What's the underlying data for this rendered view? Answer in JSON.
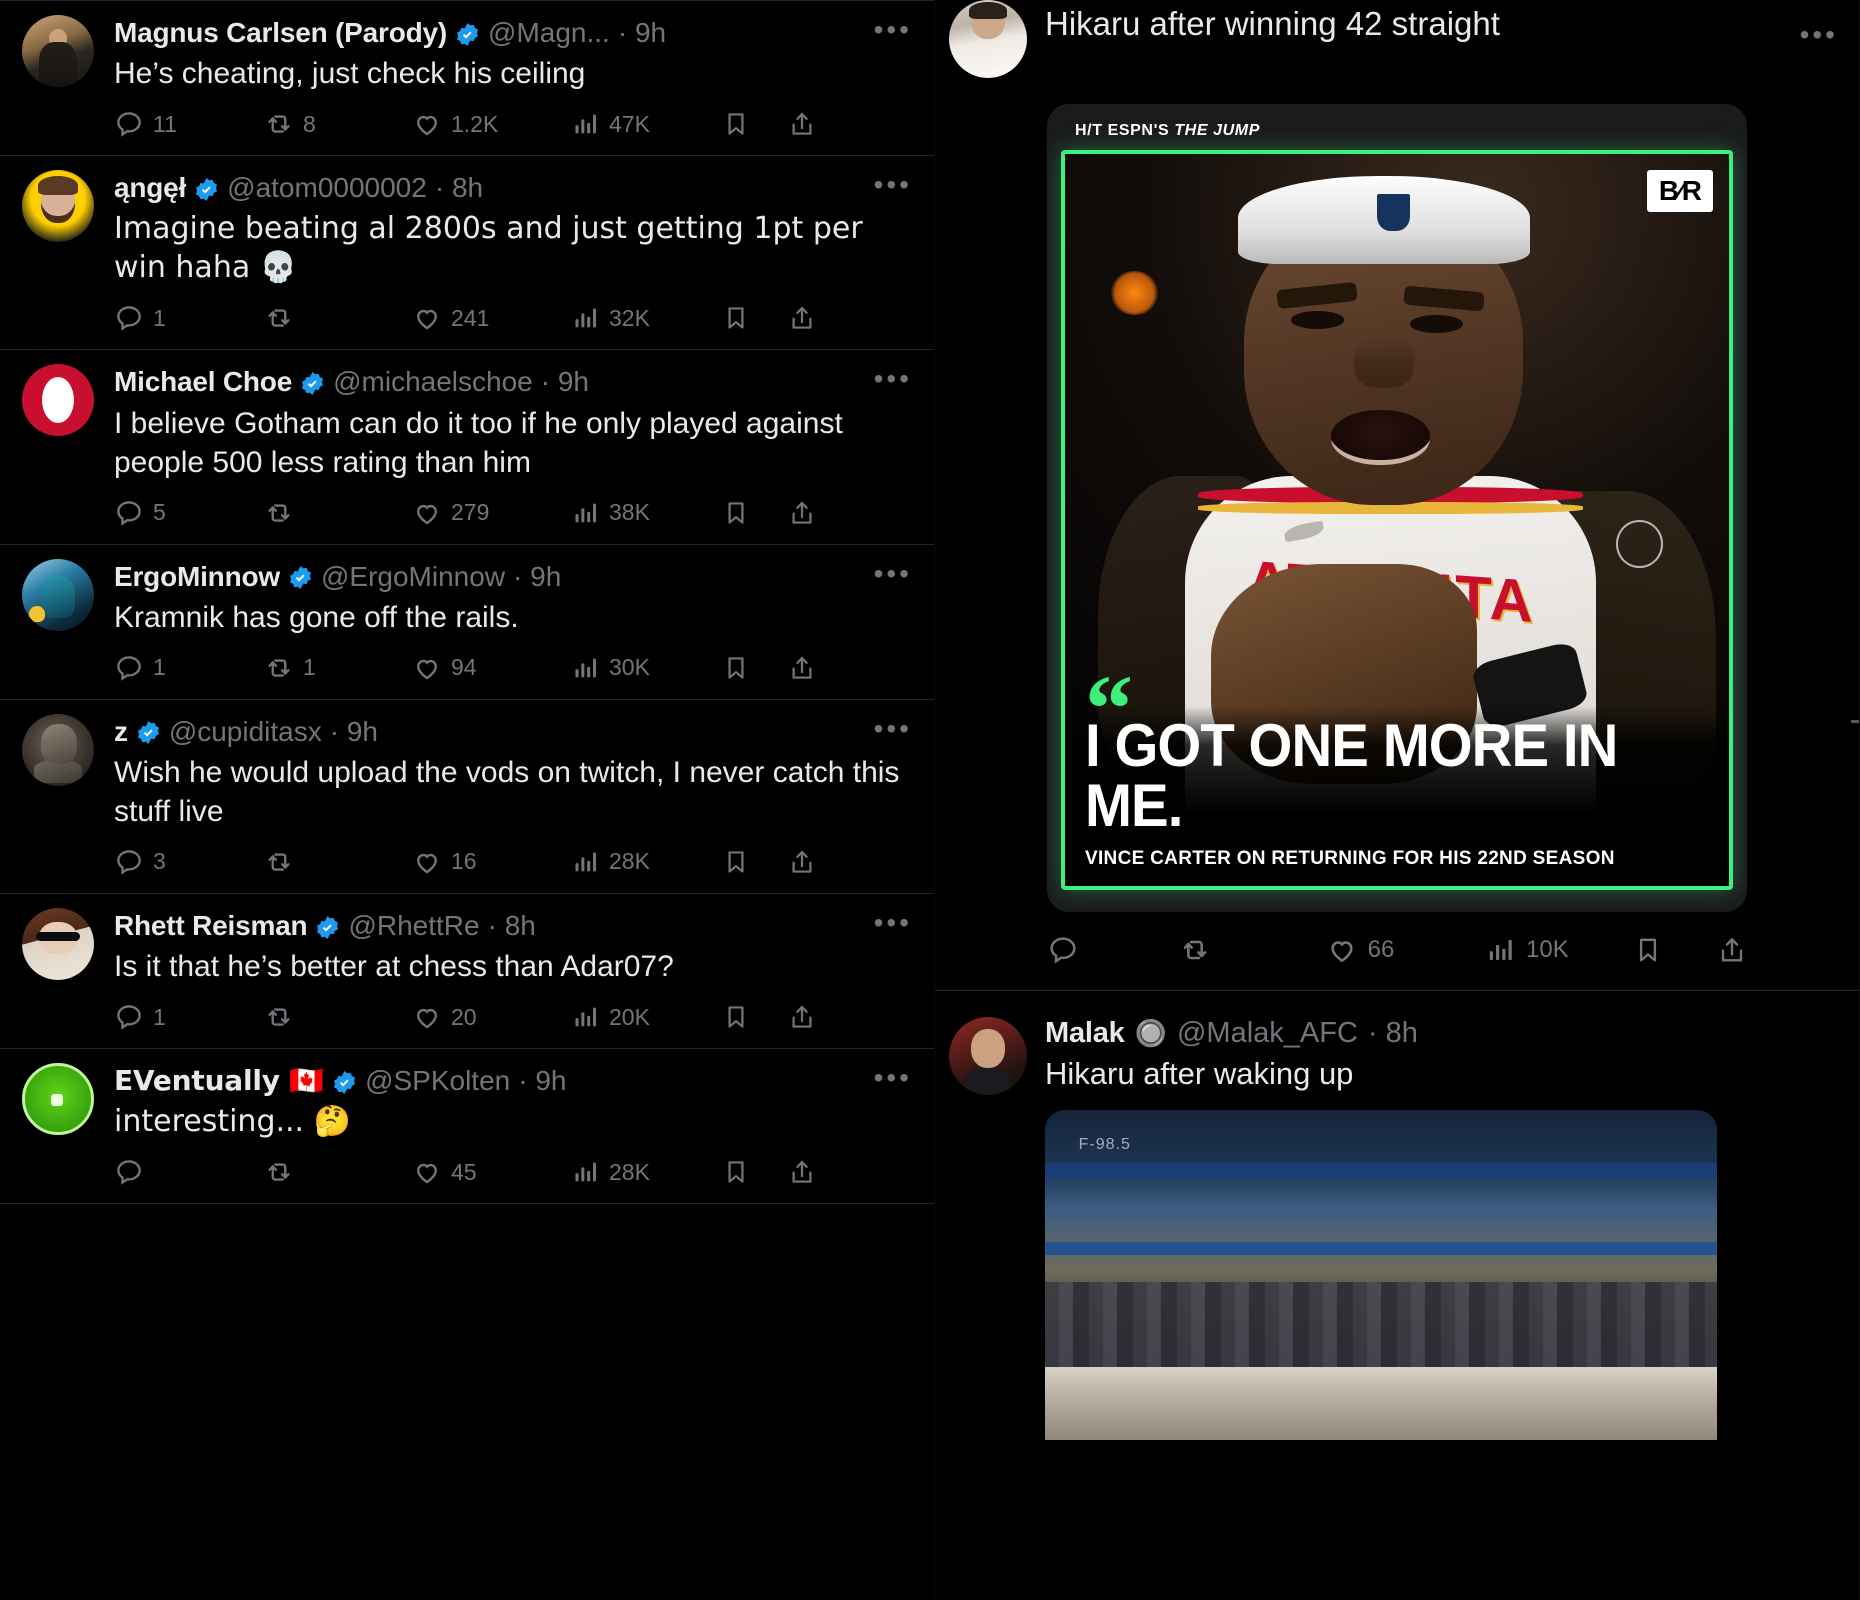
{
  "left_feed": {
    "tweets": [
      {
        "display_name": "Magnus Carlsen (Parody)",
        "handle": "@Magn...",
        "time": "9h",
        "verified": true,
        "text": "He’s cheating, just check his ceiling",
        "replies": "11",
        "retweets": "8",
        "likes": "1.2K",
        "views": "47K",
        "more": "•••"
      },
      {
        "display_name": "ąngęł",
        "handle": "@atom0000002",
        "time": "8h",
        "verified": true,
        "text": "Imagine beating al 2800s and just getting 1pt per win haha 💀",
        "replies": "1",
        "retweets": "",
        "likes": "241",
        "views": "32K",
        "more": "•••"
      },
      {
        "display_name": "Michael Choe",
        "handle": "@michaelschoe",
        "time": "9h",
        "verified": true,
        "text": "I believe Gotham can do it too if he only played against people 500 less rating than him",
        "replies": "5",
        "retweets": "",
        "likes": "279",
        "views": "38K",
        "more": "•••"
      },
      {
        "display_name": "ErgoMinnow",
        "handle": "@ErgoMinnow",
        "time": "9h",
        "verified": true,
        "text": "Kramnik has gone off the rails.",
        "replies": "1",
        "retweets": "1",
        "likes": "94",
        "views": "30K",
        "more": "•••"
      },
      {
        "display_name": "z",
        "handle": "@cupiditasx",
        "time": "9h",
        "verified": true,
        "text": "Wish he would upload the vods on twitch, I never catch this stuff live",
        "replies": "3",
        "retweets": "",
        "likes": "16",
        "views": "28K",
        "more": "•••"
      },
      {
        "display_name": "Rhett Reisman",
        "handle": "@RhettRe",
        "time": "8h",
        "verified": true,
        "text": "Is it that he’s better at chess than Adar07?",
        "replies": "1",
        "retweets": "",
        "likes": "20",
        "views": "20K",
        "more": "•••"
      },
      {
        "display_name": "EVentually 🇨🇦",
        "handle": "@SPKolten",
        "time": "9h",
        "verified": true,
        "text": "interesting... 🤔",
        "replies": "",
        "retweets": "",
        "likes": "45",
        "views": "28K",
        "more": "•••"
      }
    ]
  },
  "right_feed": {
    "top_tweet": {
      "text": "Hikaru after winning 42 straight",
      "replies": "",
      "retweets": "",
      "likes": "66",
      "views": "10K",
      "card": {
        "hat_tip_prefix": "H/T ESPN'S ",
        "hat_tip_source": "THE JUMP",
        "brand": "B⁄R",
        "quote_mark": "“",
        "quote": "I GOT ONE MORE IN ME.",
        "attribution": "VINCE CARTER ON RETURNING FOR HIS 22ND SEASON",
        "jersey_text": "ATLANTA",
        "accent_color": "#3df07a"
      }
    },
    "second_tweet": {
      "display_name": "Malak",
      "handle": "@Malak_AFC",
      "time": "8h",
      "verified_emoji": "🔘",
      "text": "Hikaru after waking up",
      "more": "•••",
      "video_label": "F-98.5"
    }
  }
}
